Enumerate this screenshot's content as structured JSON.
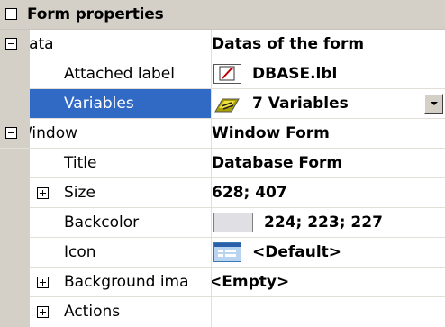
{
  "header": {
    "title": "Form properties"
  },
  "rows": [
    {
      "name": "Data",
      "value": "Datas of the form"
    },
    {
      "name": "Attached label",
      "value": "DBASE.lbl",
      "icon": "label-file-icon"
    },
    {
      "name": "Variables",
      "value": "7 Variables",
      "icon": "variables-icon"
    },
    {
      "name": "Window",
      "value": "Window Form"
    },
    {
      "name": "Title",
      "value": "Database Form"
    },
    {
      "name": "Size",
      "value": "628; 407"
    },
    {
      "name": "Backcolor",
      "value": "224; 223; 227",
      "swatch": "#e0dfe3"
    },
    {
      "name": "Icon",
      "value": "<Default>",
      "icon": "form-icon"
    },
    {
      "name": "Background ima",
      "value": "<Empty>"
    },
    {
      "name": "Actions",
      "value": ""
    }
  ],
  "colors": {
    "header_bg": "#d4d0c8",
    "selection": "#316ac5",
    "grid_line": "#e2dfd8"
  }
}
